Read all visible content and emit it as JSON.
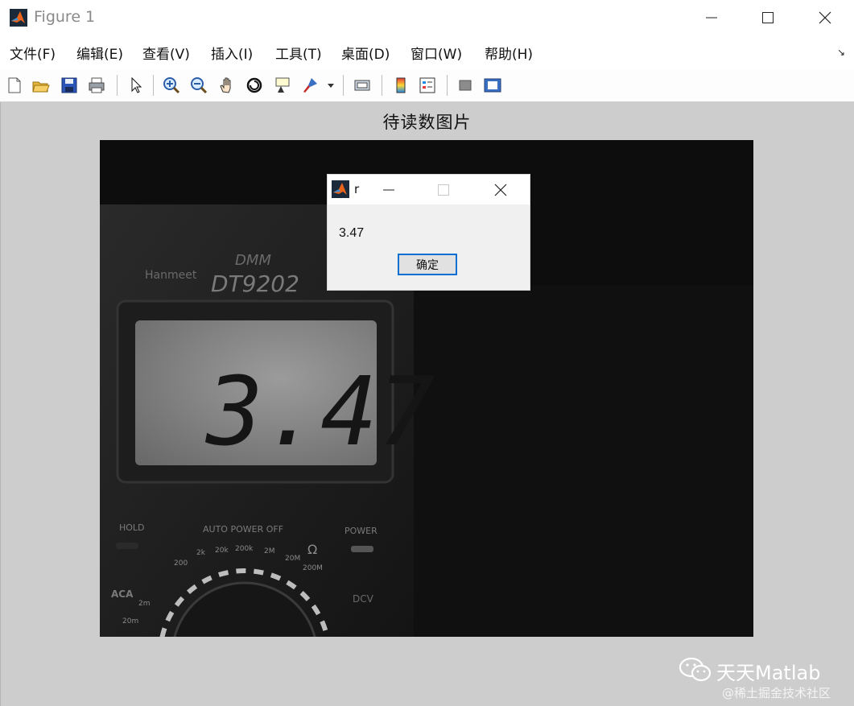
{
  "window": {
    "title": "Figure 1"
  },
  "menu": [
    "文件(F)",
    "编辑(E)",
    "查看(V)",
    "插入(I)",
    "工具(T)",
    "桌面(D)",
    "窗口(W)",
    "帮助(H)"
  ],
  "toolbar": [
    "new-figure-icon",
    "open-file-icon",
    "save-icon",
    "print-icon",
    "edit-plot-arrow-icon",
    "zoom-in-icon",
    "zoom-out-icon",
    "pan-hand-icon",
    "rotate-3d-icon",
    "data-cursor-icon",
    "brush-icon",
    "link-plot-icon",
    "colorbar-icon",
    "legend-icon",
    "hide-plot-tools-icon",
    "show-plot-tools-icon"
  ],
  "axes": {
    "title": "待读数图片"
  },
  "photo": {
    "brand": "DMM",
    "model": "DT9202",
    "maker": "Hanmeet",
    "lcd_reading": "3.47",
    "labels": {
      "hold": "HOLD",
      "auto_power_off": "AUTO POWER OFF",
      "power": "POWER",
      "aca": "ACA",
      "dcv": "DCV",
      "ohm": "Ω"
    },
    "dial": [
      "200",
      "2k",
      "20k",
      "200k",
      "2M",
      "20M",
      "200M",
      "2m",
      "20m"
    ]
  },
  "dialog": {
    "caption": "r",
    "message": "3.47",
    "ok_label": "确定"
  },
  "watermark": {
    "name": "天天Matlab",
    "site": "@稀土掘金技术社区"
  }
}
